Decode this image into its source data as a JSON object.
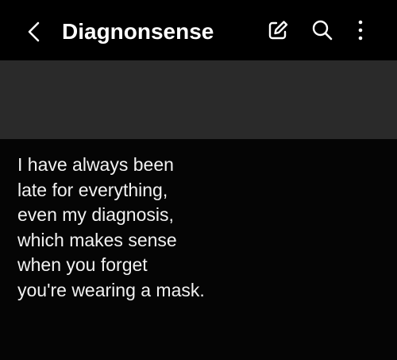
{
  "header": {
    "title": "Diagnonsense",
    "icons": {
      "back": "chevron-left-icon",
      "edit": "edit-icon",
      "search": "search-icon",
      "more": "more-vertical-icon"
    }
  },
  "note": {
    "lines": [
      "I have always been",
      "late for everything,",
      "even my diagnosis,",
      "which makes sense",
      "when you forget",
      "you're wearing a mask."
    ]
  },
  "colors": {
    "background": "#050505",
    "header": "#000000",
    "banner": "#2a2a2a",
    "text": "#f2f2f2"
  }
}
